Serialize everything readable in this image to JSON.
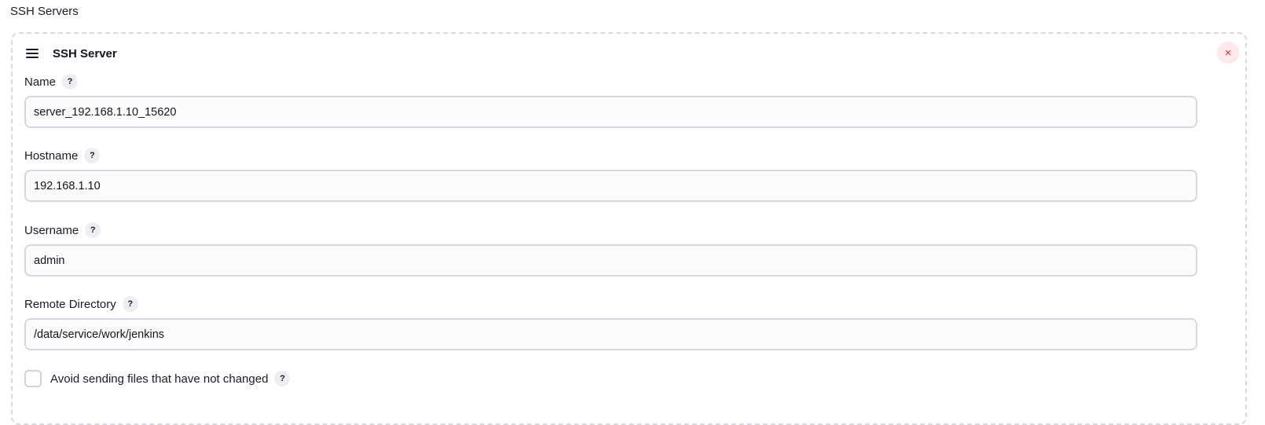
{
  "section": {
    "title": "SSH Servers"
  },
  "server": {
    "title": "SSH Server",
    "delete_label": "×",
    "help_label": "?",
    "fields": [
      {
        "label": "Name",
        "value": "server_192.168.1.10_15620"
      },
      {
        "label": "Hostname",
        "value": "192.168.1.10"
      },
      {
        "label": "Username",
        "value": "admin"
      },
      {
        "label": "Remote Directory",
        "value": "/data/service/work/jenkins"
      }
    ],
    "avoid_sending": {
      "label": "Avoid sending files that have not changed",
      "checked": false
    }
  },
  "icons": {
    "drag": "drag-handle-icon",
    "delete": "close-icon",
    "help": "help-icon"
  },
  "colors": {
    "delete": "#e0293b",
    "delete_bg": "#fde8ea",
    "border": "#d4d8e1"
  }
}
